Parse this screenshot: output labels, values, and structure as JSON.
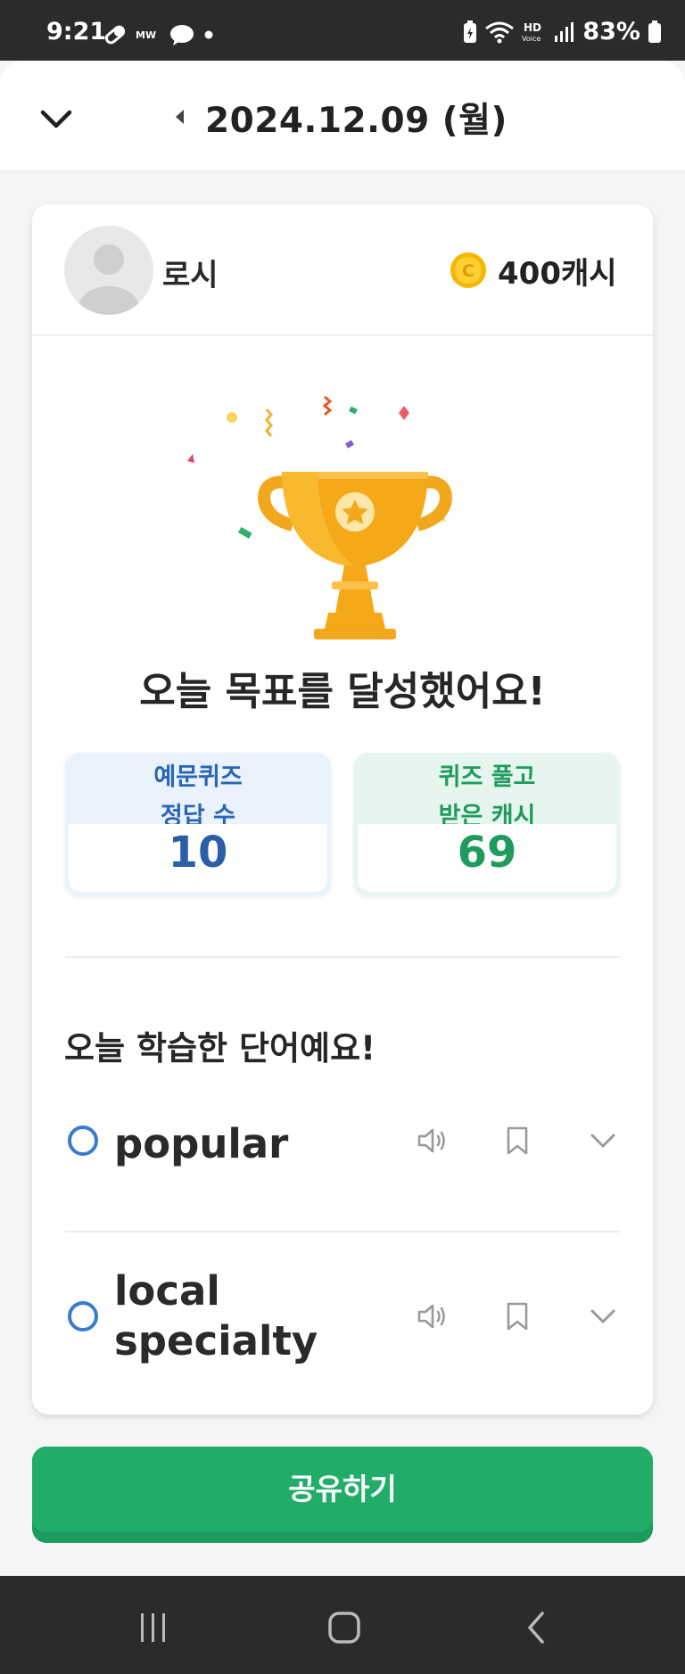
{
  "status_bar": {
    "time": "9:21",
    "battery": "83%",
    "icons": [
      "pill-icon",
      "mw-icon",
      "chat-bubble-icon",
      "dot-icon",
      "battery-saver-icon",
      "wifi-icon",
      "hd-voice-icon",
      "signal-icon",
      "battery-icon"
    ]
  },
  "header": {
    "date": "2024.12.09 (월)",
    "collapse_icon": "chevron-down-icon",
    "prev_icon": "caret-left-icon"
  },
  "profile": {
    "name": "로시",
    "cash": "400캐시",
    "coin_color": "#f5b800"
  },
  "goal": {
    "title": "오늘 목표를 달성했어요!"
  },
  "stats": [
    {
      "label_line1": "예문퀴즈",
      "label_line2": "정답 수",
      "value": "10"
    },
    {
      "label_line1": "퀴즈 풀고",
      "label_line2": "받은 캐시",
      "value": "69"
    }
  ],
  "words_section": {
    "title": "오늘 학습한 단어예요!",
    "words": [
      {
        "line1": "popular",
        "line2": ""
      },
      {
        "line1": "local",
        "line2": "specialty"
      }
    ]
  },
  "share_button": {
    "label": "공유하기",
    "color": "#21ad69"
  },
  "nav_bar": {
    "icons": [
      "recent-apps-icon",
      "home-icon",
      "back-icon"
    ]
  }
}
